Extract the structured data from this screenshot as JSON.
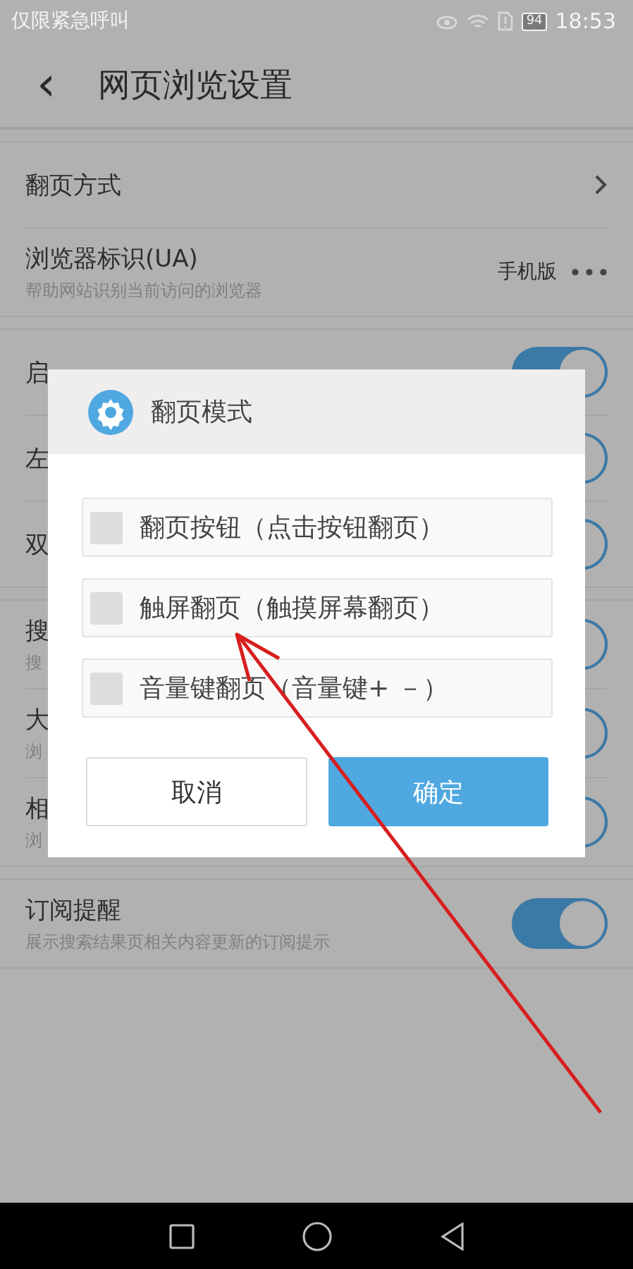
{
  "status_bar": {
    "carrier": "仅限紧急呼叫",
    "battery": "94",
    "time": "18:53"
  },
  "toolbar": {
    "back": "‹",
    "title": "网页浏览设置"
  },
  "sections": [
    {
      "rows": [
        {
          "kind": "chevron",
          "title": "翻页方式"
        },
        {
          "kind": "value",
          "title": "浏览器标识(UA)",
          "subtitle": "帮助网站识别当前访问的浏览器",
          "value": "手机版"
        }
      ]
    },
    {
      "rows": [
        {
          "kind": "toggle",
          "title": "启",
          "on": true
        },
        {
          "kind": "toggle",
          "title": "左",
          "on": true
        },
        {
          "kind": "toggle",
          "title": "双",
          "on": true
        }
      ]
    },
    {
      "rows": [
        {
          "kind": "toggle",
          "title": "搜",
          "subtitle": "搜",
          "on": true
        },
        {
          "kind": "toggle",
          "title": "大",
          "subtitle": "浏",
          "on": true
        },
        {
          "kind": "toggle",
          "title": "相",
          "subtitle": "浏",
          "on": true
        }
      ]
    },
    {
      "rows": [
        {
          "kind": "toggle",
          "title": "订阅提醒",
          "subtitle": "展示搜索结果页相关内容更新的订阅提示",
          "on": true
        }
      ]
    }
  ],
  "dialog": {
    "title": "翻页模式",
    "options": [
      {
        "label": "翻页按钮（点击按钮翻页）",
        "checked": false
      },
      {
        "label": "触屏翻页（触摸屏幕翻页）",
        "checked": false
      },
      {
        "label": "音量键翻页（音量键+ －）",
        "checked": false
      }
    ],
    "cancel": "取消",
    "confirm": "确定"
  }
}
